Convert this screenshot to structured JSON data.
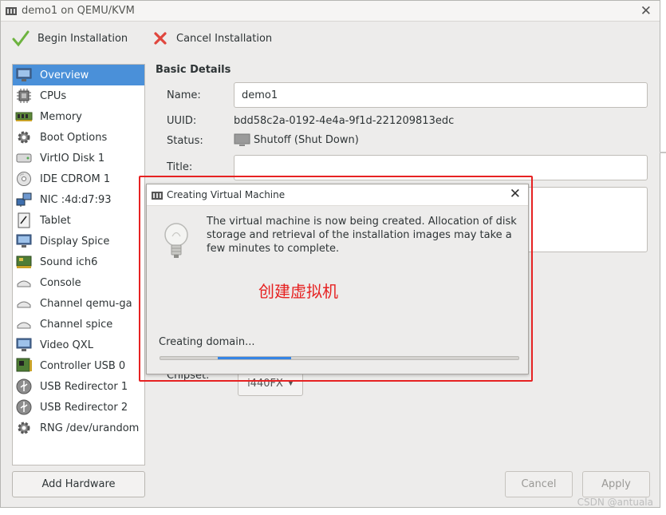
{
  "window": {
    "title": "demo1 on QEMU/KVM",
    "close_icon": "close-icon"
  },
  "toolbar": {
    "begin": "Begin Installation",
    "cancel": "Cancel Installation"
  },
  "sidebar": {
    "items": [
      {
        "label": "Overview",
        "icon": "monitor-icon"
      },
      {
        "label": "CPUs",
        "icon": "cpu-icon"
      },
      {
        "label": "Memory",
        "icon": "memory-icon"
      },
      {
        "label": "Boot Options",
        "icon": "gear-icon"
      },
      {
        "label": "VirtIO Disk 1",
        "icon": "disk-icon"
      },
      {
        "label": "IDE CDROM 1",
        "icon": "cdrom-icon"
      },
      {
        "label": "NIC :4d:d7:93",
        "icon": "network-icon"
      },
      {
        "label": "Tablet",
        "icon": "tablet-icon"
      },
      {
        "label": "Display Spice",
        "icon": "display-icon"
      },
      {
        "label": "Sound ich6",
        "icon": "sound-card-icon"
      },
      {
        "label": "Console",
        "icon": "console-icon"
      },
      {
        "label": "Channel qemu-ga",
        "icon": "channel-icon"
      },
      {
        "label": "Channel spice",
        "icon": "channel-icon"
      },
      {
        "label": "Video QXL",
        "icon": "video-icon"
      },
      {
        "label": "Controller USB 0",
        "icon": "controller-icon"
      },
      {
        "label": "USB Redirector 1",
        "icon": "usb-icon"
      },
      {
        "label": "USB Redirector 2",
        "icon": "usb-icon"
      },
      {
        "label": "RNG /dev/urandom",
        "icon": "rng-icon"
      }
    ],
    "add_hardware": "Add Hardware"
  },
  "details": {
    "heading": "Basic Details",
    "name_label": "Name:",
    "name_value": "demo1",
    "uuid_label": "UUID:",
    "uuid_value": "bdd58c2a-0192-4e4a-9f1d-221209813edc",
    "status_label": "Status:",
    "status_value": "Shutoff (Shut Down)",
    "title_label": "Title:",
    "title_value": "",
    "chipset_label": "Chipset:",
    "chipset_value": "i440FX"
  },
  "buttons": {
    "cancel": "Cancel",
    "apply": "Apply"
  },
  "dialog": {
    "title": "Creating Virtual Machine",
    "message": "The virtual machine is now being created. Allocation of disk storage and retrieval of the installation images may take a few minutes to complete.",
    "annotation": "创建虚拟机",
    "status": "Creating domain..."
  },
  "watermark": "CSDN @antuala",
  "colors": {
    "selection": "#4a90d9",
    "annotation": "#e62222",
    "progress": "#3584e4"
  }
}
